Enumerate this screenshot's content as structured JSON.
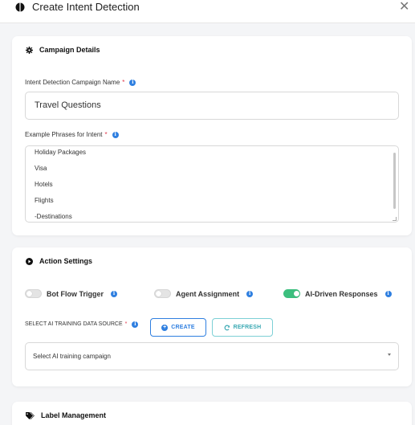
{
  "header": {
    "title": "Create Intent Detection",
    "close_symbol": "✕"
  },
  "campaign_details": {
    "heading": "Campaign Details",
    "name_label": "Intent Detection Campaign Name",
    "required_mark": "*",
    "name_value": "Travel Questions",
    "phrases_label": "Example Phrases for Intent",
    "phrases": [
      "Holiday Packages",
      "Visa",
      "Hotels",
      "Flights",
      "-Destinations"
    ]
  },
  "action_settings": {
    "heading": "Action Settings",
    "toggles": [
      {
        "label": "Bot Flow Trigger",
        "enabled": false
      },
      {
        "label": "Agent Assignment",
        "enabled": false
      },
      {
        "label": "AI-Driven Responses",
        "enabled": true
      }
    ],
    "data_source_label": "SELECT AI TRAINING DATA SOURCE",
    "create_label": "CREATE",
    "refresh_label": "REFRESH",
    "select_placeholder": "Select AI training campaign"
  },
  "label_management": {
    "heading": "Label Management"
  },
  "colors": {
    "accent": "#2f7fe0",
    "toggle_on": "#3cbf7e",
    "required": "#e0384b",
    "refresh": "#3aa9b3"
  },
  "info_glyph": "i"
}
